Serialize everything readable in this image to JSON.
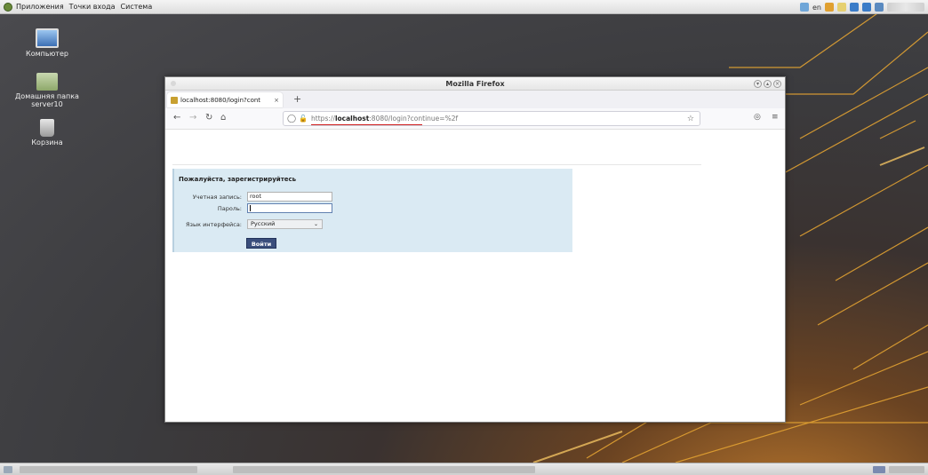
{
  "top_panel": {
    "menu": [
      "Приложения",
      "Точки входа",
      "Система"
    ],
    "tray_lang": "en"
  },
  "desktop": {
    "icons": [
      {
        "label": "Компьютер",
        "icon": "computer-icon"
      },
      {
        "label": "Домашняя папка server10",
        "icon": "home-folder-icon"
      },
      {
        "label": "Корзина",
        "icon": "trash-icon"
      }
    ]
  },
  "window": {
    "title": "Mozilla Firefox",
    "tab_title": "localhost:8080/login?cont",
    "tab_close": "×",
    "new_tab": "+",
    "url_scheme": "https://",
    "url_host": "localhost",
    "url_rest": ":8080/login?continue=%2f"
  },
  "login": {
    "title": "Пожалуйста, зарегистрируйтесь",
    "account_label": "Учетная запись:",
    "account_value": "root",
    "password_label": "Пароль:",
    "language_label": "Язык интерфейса:",
    "language_value": "Русский",
    "submit_label": "Войти"
  },
  "colors": {
    "login_panel_bg": "#daeaf3",
    "login_button_bg": "#3a4e7c",
    "url_underline": "#d02020"
  }
}
